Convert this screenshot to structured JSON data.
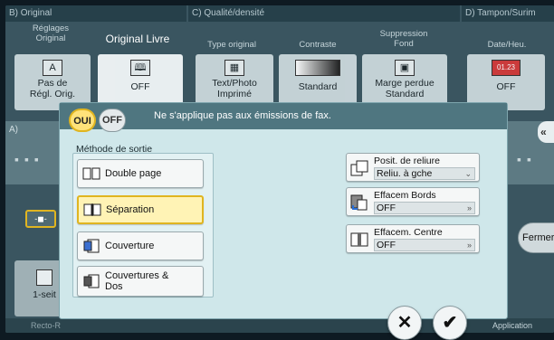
{
  "header": {
    "col_b": "B) Original",
    "col_c": "C) Qualité/densité",
    "col_d": "D) Tampon/Surim"
  },
  "columns": {
    "reglages": "Réglages\nOriginal",
    "original_livre": "Original Livre",
    "type_original": "Type original",
    "contraste": "Contraste",
    "suppression_fond": "Suppression\nFond",
    "date_heure": "Date/Heu."
  },
  "tiles": {
    "pas_de": "Pas de\nRégl. Orig.",
    "off1": "OFF",
    "text_photo": "Text/Photo\nImprimé",
    "standard": "Standard",
    "marge": "Marge perdue\nStandard",
    "off2": "OFF",
    "a_label": "A)",
    "un_seit": "1-seit",
    "date_icon_text": "01.23"
  },
  "bottom": {
    "recto": "Recto-R",
    "application": "Application"
  },
  "dialog": {
    "toggle_on": "OUI",
    "toggle_off": "OFF",
    "notice": "Ne s'applique pas aux émissions de fax.",
    "method_label": "Méthode de sortie",
    "buttons": {
      "double_page": "Double page",
      "separation": "Séparation",
      "couverture": "Couverture",
      "couvertures_dos": "Couvertures &\nDos"
    },
    "right": {
      "reliure_title": "Posit. de reliure",
      "reliure_value": "Reliu. à gche",
      "bords_title": "Effacem Bords",
      "bords_value": "OFF",
      "centre_title": "Effacem. Centre",
      "centre_value": "OFF"
    }
  },
  "fermer": "Fermer",
  "icons": [
    "cancel-icon",
    "check-icon",
    "chevron-double-left-icon"
  ]
}
